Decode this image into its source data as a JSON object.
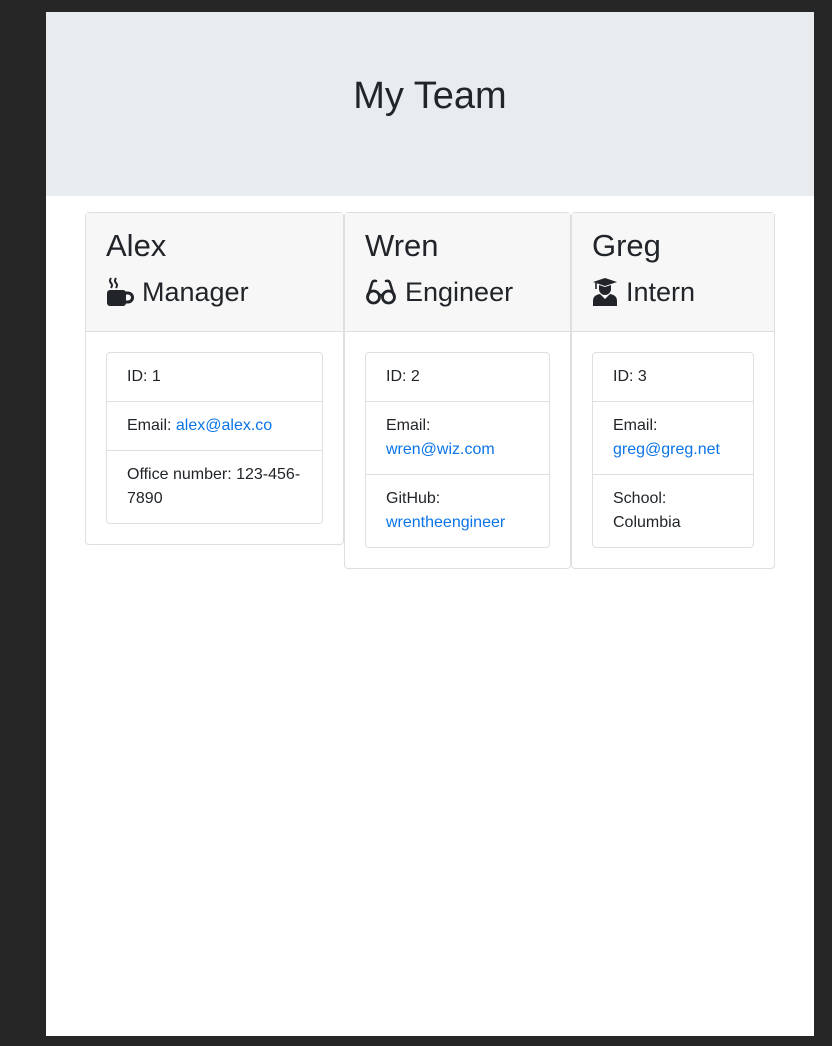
{
  "header": {
    "title": "My Team"
  },
  "employees": [
    {
      "name": "Alex",
      "role": "Manager",
      "icon": "coffee-icon",
      "id_label": "ID: 1",
      "email_label": "Email:",
      "email": "alex@alex.co",
      "extra_label": "Office number:",
      "extra_value": "123-456-7890"
    },
    {
      "name": "Wren",
      "role": "Engineer",
      "icon": "glasses-icon",
      "id_label": "ID: 2",
      "email_label": "Email:",
      "email": "wren@wiz.com",
      "extra_label": "GitHub:",
      "extra_value": "wrentheengineer"
    },
    {
      "name": "Greg",
      "role": "Intern",
      "icon": "graduate-icon",
      "id_label": "ID: 3",
      "email_label": "Email:",
      "email": "greg@greg.net",
      "extra_label": "School:",
      "extra_value": "Columbia"
    }
  ],
  "colors": {
    "link": "#0a74e8",
    "header_bg": "#e9ecef",
    "card_header_bg": "#f7f7f7"
  }
}
